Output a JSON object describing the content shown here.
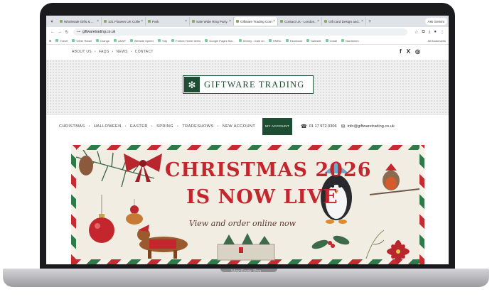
{
  "device": {
    "model_label": "MacBook Pro"
  },
  "browser": {
    "tabs": [
      {
        "label": "Wholesale Gifts & ...",
        "active": false
      },
      {
        "label": "101 Flowers UK Collections",
        "active": false
      },
      {
        "label": "Park",
        "active": false
      },
      {
        "label": "Sale Wide Ring Party...",
        "active": false
      },
      {
        "label": "Giftware Trading Com",
        "active": true
      },
      {
        "label": "Contact Us - London...",
        "active": false
      },
      {
        "label": "Gift card Design and...",
        "active": false
      }
    ],
    "new_tab_label": "+",
    "ask_gemini_label": "Ask Gemini",
    "url": "giftwaretrading.co.uk",
    "bookmarks": [
      "Travel",
      "Other Retail",
      "Orange",
      "ASAP",
      "Website Speed",
      "Tidy",
      "Forbes Home Items",
      "Google Pages Sta...",
      "Money - Gain on",
      "HMRC",
      "Facebook",
      "Salesbit",
      "Gmail",
      "Nordstrom"
    ],
    "all_bookmarks_label": "All Bookmarks"
  },
  "site": {
    "top_links": [
      "ABOUT US",
      "FAQS",
      "NEWS",
      "CONTACT"
    ],
    "social": [
      "f",
      "X",
      "◎"
    ],
    "logo_text": "GIFTWARE TRADING",
    "nav": [
      "CHRISTMAS",
      "HALLOWEEN",
      "EASTER",
      "SPRING",
      "TRADESHOWS",
      "NEW ACCOUNT"
    ],
    "my_account_label": "MY ACCOUNT",
    "phone": "01 17 972 0306",
    "email": "info@giftwaretrading.co.uk"
  },
  "banner": {
    "title_line1": "CHRISTMAS 2026",
    "title_line2": "IS NOW LIVE",
    "subtitle": "View and order online now"
  },
  "colors": {
    "brand_green": "#1d4d33",
    "banner_red": "#c3262d"
  }
}
